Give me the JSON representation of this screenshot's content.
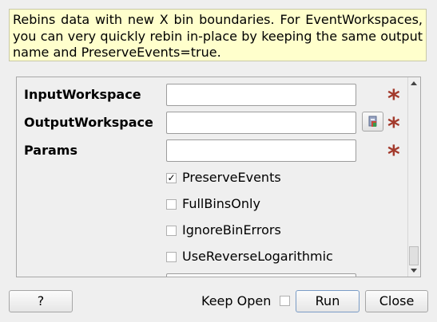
{
  "description": "Rebins data with new X bin boundaries. For EventWorkspaces, you can very quickly rebin in-place by keeping the same output name and PreserveEvents=true.",
  "properties": [
    {
      "label": "InputWorkspace",
      "value": "",
      "required_mark": "*"
    },
    {
      "label": "OutputWorkspace",
      "value": "",
      "required_mark": "*"
    },
    {
      "label": "Params",
      "value": "",
      "required_mark": "*"
    }
  ],
  "checkboxes": [
    {
      "label": "PreserveEvents",
      "checked": true,
      "mark": "✓"
    },
    {
      "label": "FullBinsOnly",
      "checked": false,
      "mark": ""
    },
    {
      "label": "IgnoreBinErrors",
      "checked": false,
      "mark": ""
    },
    {
      "label": "UseReverseLogarithmic",
      "checked": false,
      "mark": ""
    }
  ],
  "footer": {
    "help_label": "?",
    "keep_open_label": "Keep Open",
    "keep_open_checked": false,
    "run_label": "Run",
    "close_label": "Close"
  },
  "colors": {
    "description_bg": "#ffffcc",
    "required_mark": "#a33a2c"
  },
  "icons": {
    "browse": "workspace-browse-icon"
  }
}
